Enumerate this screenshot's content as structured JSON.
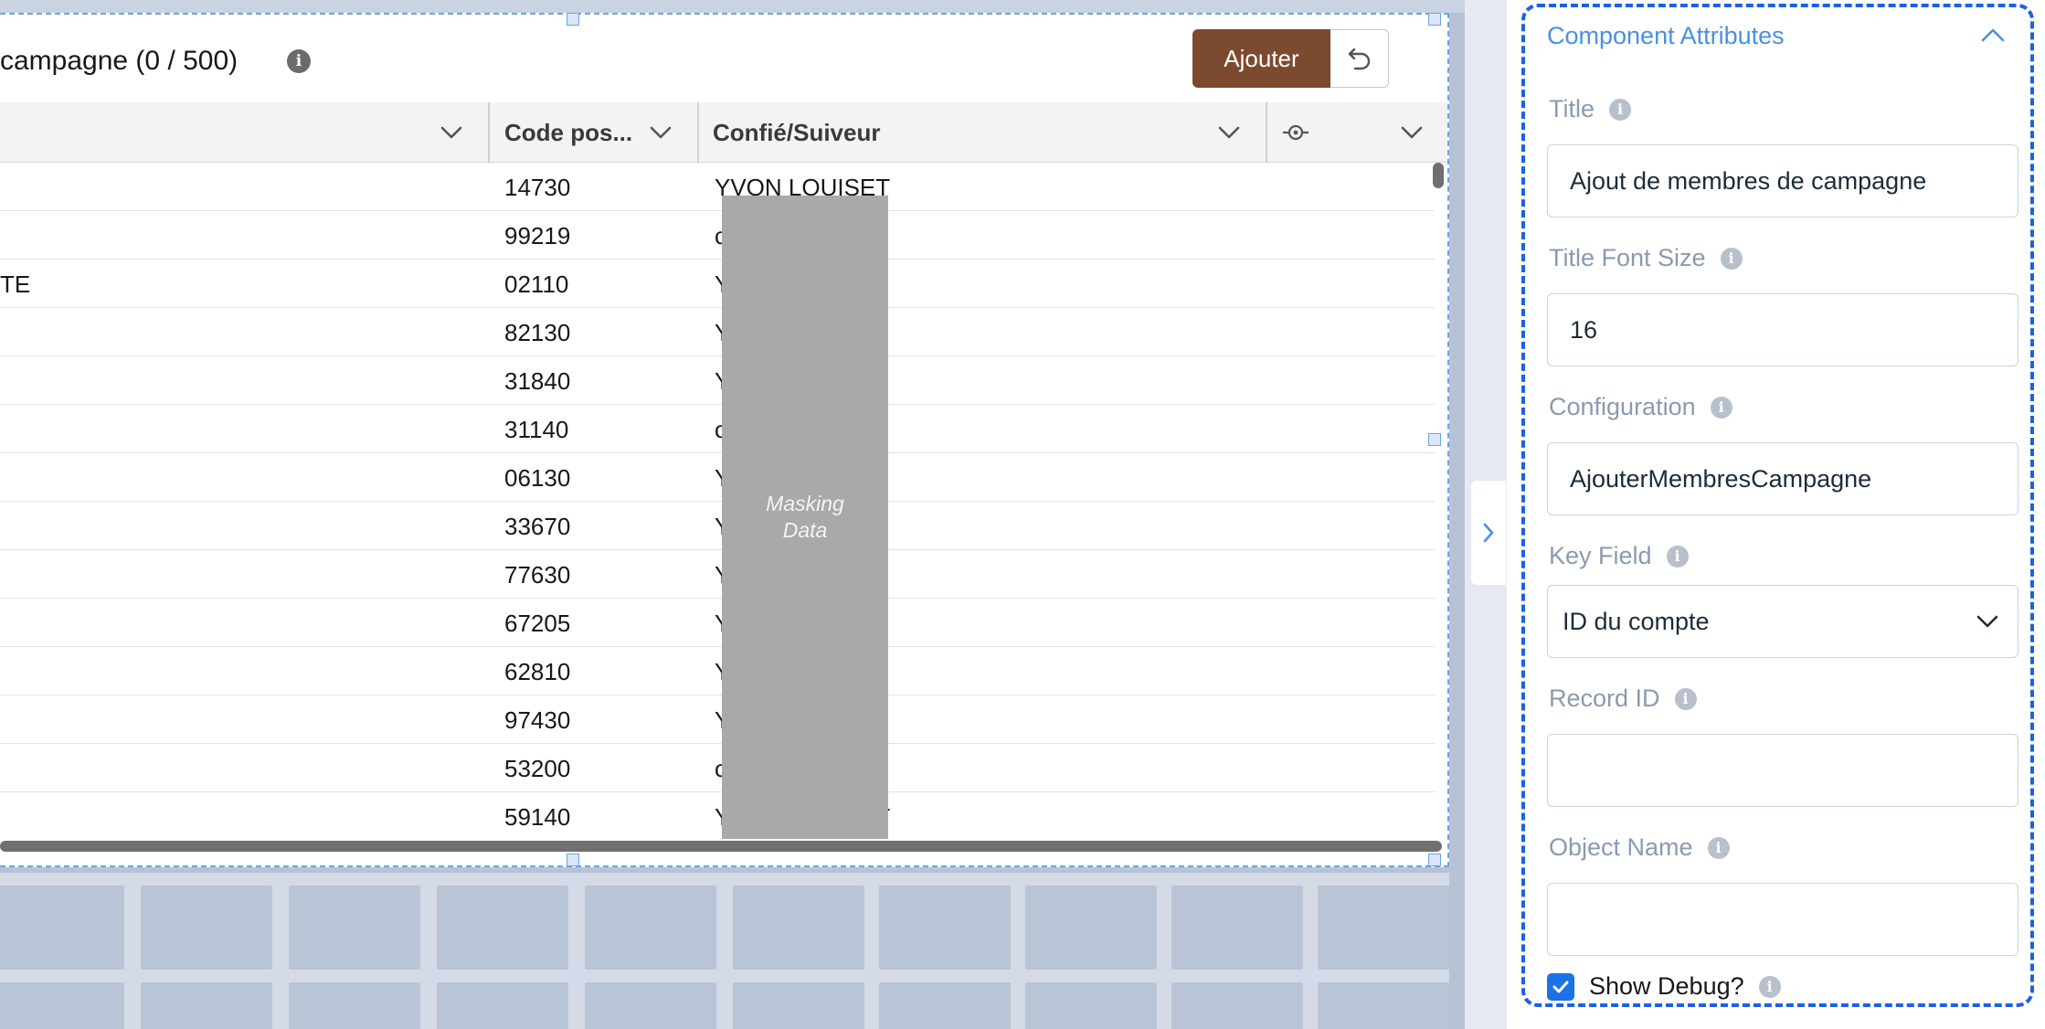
{
  "table": {
    "title": "campagne (0 / 500)",
    "add_label": "Ajouter",
    "columns": {
      "zip": "Code pos...",
      "owner": "Confié/Suiveur"
    },
    "rows": [
      {
        "col_a": "",
        "zip": "14730",
        "owner": "YVON LOUISET"
      },
      {
        "col_a": "",
        "zip": "99219",
        "owner": "c          n"
      },
      {
        "col_a": "TE",
        "zip": "02110",
        "owner": "Y"
      },
      {
        "col_a": "",
        "zip": "82130",
        "owner": "Y"
      },
      {
        "col_a": "",
        "zip": "31840",
        "owner": "Y"
      },
      {
        "col_a": "",
        "zip": "31140",
        "owner": "c          n"
      },
      {
        "col_a": "",
        "zip": "06130",
        "owner": "Y"
      },
      {
        "col_a": "",
        "zip": "33670",
        "owner": "Y"
      },
      {
        "col_a": "",
        "zip": "77630",
        "owner": "Y"
      },
      {
        "col_a": "",
        "zip": "67205",
        "owner": "Y"
      },
      {
        "col_a": "",
        "zip": "62810",
        "owner": "Y"
      },
      {
        "col_a": "",
        "zip": "97430",
        "owner": "Y"
      },
      {
        "col_a": "",
        "zip": "53200",
        "owner": "c          n"
      },
      {
        "col_a": "",
        "zip": "59140",
        "owner": "YVON LOUISET"
      }
    ],
    "mask_text": "Masking Data"
  },
  "panel": {
    "section_title": "Component Attributes",
    "fields": {
      "title": {
        "label": "Title",
        "value": "Ajout de membres de campagne"
      },
      "title_font_size": {
        "label": "Title Font Size",
        "value": "16"
      },
      "configuration": {
        "label": "Configuration",
        "value": "AjouterMembresCampagne"
      },
      "key_field": {
        "label": "Key Field",
        "value": "ID du compte"
      },
      "record_id": {
        "label": "Record ID",
        "value": ""
      },
      "object_name": {
        "label": "Object Name",
        "value": ""
      }
    },
    "show_debug": {
      "label": "Show Debug?",
      "checked": true
    }
  },
  "colors": {
    "add_button": "#7c4a2f",
    "section_border": "#1b61e4",
    "section_title": "#4a90e2",
    "checkbox": "#1b72e8",
    "mask": "#a9a9a9"
  },
  "icons": [
    "info-icon",
    "undo-icon",
    "chevron-down-icon",
    "target-icon",
    "chevron-right-icon",
    "chevron-up-icon",
    "check-icon"
  ]
}
